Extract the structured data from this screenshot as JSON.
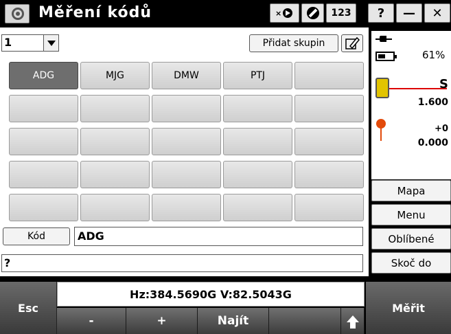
{
  "window": {
    "title": "Měření kódů",
    "toolbar": {
      "digits_label": "123"
    },
    "controls": {
      "help": "?",
      "minimize": "—",
      "close": "✕"
    }
  },
  "group": {
    "selected": "1",
    "add_group_label": "Přidat skupin"
  },
  "code_buttons": [
    {
      "label": "ADG",
      "selected": true
    },
    {
      "label": "MJG",
      "selected": false
    },
    {
      "label": "DMW",
      "selected": false
    },
    {
      "label": "PTJ",
      "selected": false
    },
    {
      "label": "",
      "selected": false
    },
    {
      "label": ""
    },
    {
      "label": ""
    },
    {
      "label": ""
    },
    {
      "label": ""
    },
    {
      "label": ""
    },
    {
      "label": ""
    },
    {
      "label": ""
    },
    {
      "label": ""
    },
    {
      "label": ""
    },
    {
      "label": ""
    },
    {
      "label": ""
    },
    {
      "label": ""
    },
    {
      "label": ""
    },
    {
      "label": ""
    },
    {
      "label": ""
    },
    {
      "label": ""
    },
    {
      "label": ""
    },
    {
      "label": ""
    },
    {
      "label": ""
    },
    {
      "label": ""
    }
  ],
  "code_field": {
    "label": "Kód",
    "value": "ADG"
  },
  "description_field": {
    "value": "?"
  },
  "status": {
    "battery_percent": "61%",
    "instrument_mode": "S",
    "instrument_height": "1.600",
    "target_offset": "+0",
    "target_height": "0.000"
  },
  "side_menu": {
    "map": "Mapa",
    "menu": "Menu",
    "favorites": "Oblíbené",
    "jump": "Skoč do"
  },
  "bottom": {
    "esc": "Esc",
    "readout": "Hz:384.5690G  V:82.5043G",
    "minus": "-",
    "plus": "+",
    "find": "Najít",
    "measure": "Měřit"
  }
}
